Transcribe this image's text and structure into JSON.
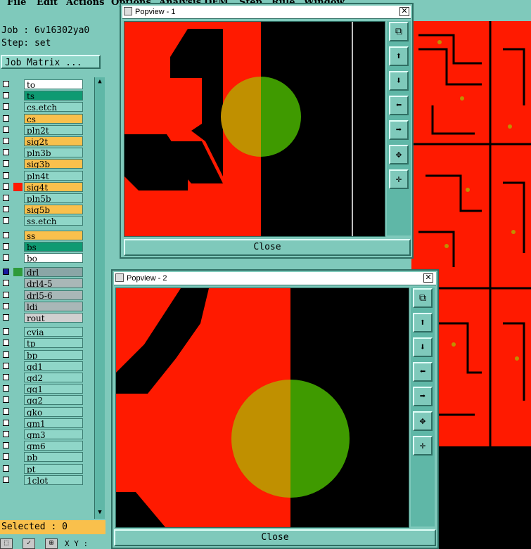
{
  "menubar": {
    "items": [
      "File",
      "Edit",
      "Actions",
      "Options",
      "Analysis",
      "DFM",
      "Step",
      "Rule",
      "Window"
    ]
  },
  "job": {
    "label": "Job : 6v16302ya0",
    "step": "Step: set"
  },
  "job_matrix_button": "Job Matrix ...",
  "layers": [
    {
      "name": "to",
      "color": "#ffffff",
      "checked": false
    },
    {
      "name": "ts",
      "color": "#0e9a72",
      "checked": false
    },
    {
      "name": "cs.etch",
      "color": "#8fd6c8",
      "checked": false
    },
    {
      "name": "cs",
      "color": "#f9c04c",
      "checked": false
    },
    {
      "name": "pln2t",
      "color": "#8fd6c8",
      "checked": false
    },
    {
      "name": "sig2t",
      "color": "#f9c04c",
      "checked": false
    },
    {
      "name": "pln3b",
      "color": "#8fd6c8",
      "checked": false
    },
    {
      "name": "sig3b",
      "color": "#f9c04c",
      "checked": false
    },
    {
      "name": "pln4t",
      "color": "#8fd6c8",
      "checked": false
    },
    {
      "name": "sig4t",
      "color": "#f9c04c",
      "checked": false,
      "swatch": "#ff1a00"
    },
    {
      "name": "pln5b",
      "color": "#8fd6c8",
      "checked": false
    },
    {
      "name": "sig5b",
      "color": "#f9c04c",
      "checked": false
    },
    {
      "name": "ss.etch",
      "color": "#8fd6c8",
      "checked": false
    },
    {
      "name": "ss",
      "color": "#f9c04c",
      "checked": false
    },
    {
      "name": "bs",
      "color": "#0e9a72",
      "checked": false
    },
    {
      "name": "bo",
      "color": "#ffffff",
      "checked": false
    },
    {
      "name": "drl",
      "color": "#8aa6a6",
      "checked": true,
      "swatch": "#2e9a3a"
    },
    {
      "name": "drl4-5",
      "color": "#a9b7b7",
      "checked": false
    },
    {
      "name": "drl5-6",
      "color": "#a9b7b7",
      "checked": false
    },
    {
      "name": "ldi",
      "color": "#a9b7b7",
      "checked": false
    },
    {
      "name": "rout",
      "color": "#d0d0d0",
      "checked": false
    },
    {
      "name": "cvia",
      "color": "#8fd6c8",
      "checked": false
    },
    {
      "name": "tp",
      "color": "#8fd6c8",
      "checked": false
    },
    {
      "name": "bp",
      "color": "#8fd6c8",
      "checked": false
    },
    {
      "name": "gd1",
      "color": "#8fd6c8",
      "checked": false
    },
    {
      "name": "gd2",
      "color": "#8fd6c8",
      "checked": false
    },
    {
      "name": "gg1",
      "color": "#8fd6c8",
      "checked": false
    },
    {
      "name": "gg2",
      "color": "#8fd6c8",
      "checked": false
    },
    {
      "name": "gko",
      "color": "#8fd6c8",
      "checked": false
    },
    {
      "name": "gm1",
      "color": "#8fd6c8",
      "checked": false
    },
    {
      "name": "gm3",
      "color": "#8fd6c8",
      "checked": false
    },
    {
      "name": "gm6",
      "color": "#8fd6c8",
      "checked": false
    },
    {
      "name": "pb",
      "color": "#8fd6c8",
      "checked": false
    },
    {
      "name": "pt",
      "color": "#8fd6c8",
      "checked": false
    },
    {
      "name": "1clot",
      "color": "#8fd6c8",
      "checked": false
    }
  ],
  "selected": "Selected : 0",
  "coords_label": "X Y :",
  "popview1": {
    "title": "Popview - 1",
    "close": "Close",
    "x": "✕"
  },
  "popview2": {
    "title": "Popview - 2",
    "close": "Close",
    "x": "✕"
  },
  "toolbar_icons": [
    "zoom-fit-icon",
    "pan-up-icon",
    "pan-down-icon",
    "pan-left-icon",
    "pan-right-icon",
    "zoom-in-icon",
    "zoom-out-icon"
  ],
  "colors": {
    "copper": "#ff1a00",
    "pad": "#c09000",
    "drill": "#3f9a00",
    "board_bg": "#000000",
    "accent": "#7fc9bb"
  }
}
